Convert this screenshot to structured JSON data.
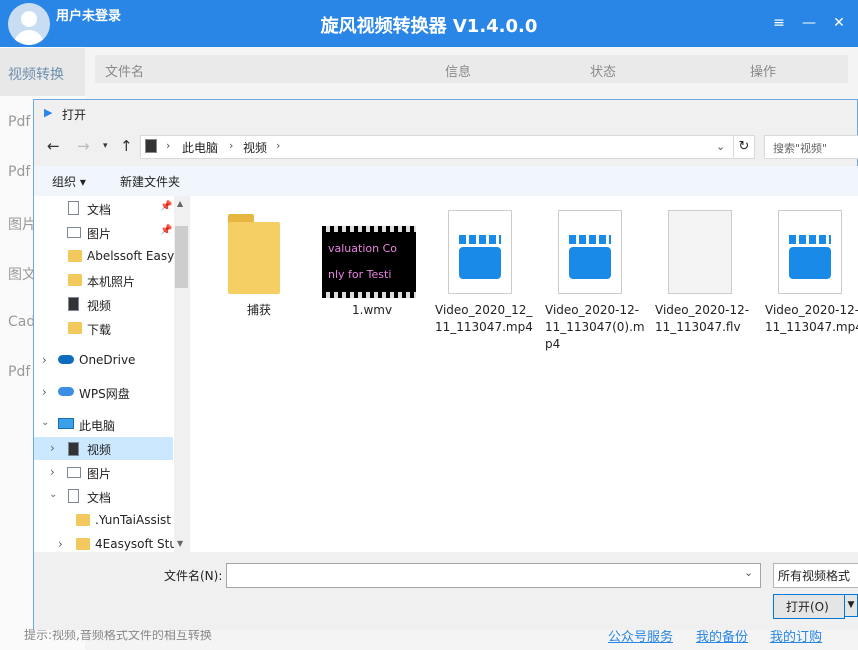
{
  "app": {
    "user_label": "用户未登录",
    "title": "旋风视频转换器 V1.4.0.0",
    "window_buttons": [
      "≡",
      "—",
      "☐",
      "✕"
    ]
  },
  "sidebar": {
    "items": [
      {
        "label": "视频转换"
      },
      {
        "label": "Pdf"
      },
      {
        "label": "Pdf"
      },
      {
        "label": "图片"
      },
      {
        "label": "图文"
      },
      {
        "label": "Cad"
      },
      {
        "label": "Pdf"
      }
    ]
  },
  "table": {
    "columns": [
      "文件名",
      "信息",
      "状态",
      "操作"
    ]
  },
  "statusbar": {
    "hint": "提示:视频,音频格式文件的相互转换",
    "links": [
      "公众号服务",
      "我的备份",
      "我的订购"
    ]
  },
  "dialog": {
    "title": "打开",
    "breadcrumb": [
      "此电脑",
      "视频"
    ],
    "search_placeholder": "搜索\"视频\"",
    "toolbar": {
      "organize": "组织 ▾",
      "new_folder": "新建文件夹"
    },
    "nav_items": [
      {
        "label": "文档",
        "icon": "document-icon",
        "pinned": true
      },
      {
        "label": "图片",
        "icon": "pictures-icon",
        "pinned": true
      },
      {
        "label": "Abelssoft Easy",
        "icon": "folder-icon"
      },
      {
        "label": "本机照片",
        "icon": "folder-icon"
      },
      {
        "label": "视频",
        "icon": "video-folder-icon"
      },
      {
        "label": "下载",
        "icon": "folder-icon"
      },
      {
        "label": "OneDrive",
        "icon": "cloud-icon"
      },
      {
        "label": "WPS网盘",
        "icon": "cloud-icon"
      },
      {
        "label": "此电脑",
        "icon": "computer-icon"
      },
      {
        "label": "视频",
        "icon": "video-folder-icon"
      },
      {
        "label": "图片",
        "icon": "pictures-icon"
      },
      {
        "label": "文档",
        "icon": "document-icon"
      },
      {
        "label": ".YunTaiAssist",
        "icon": "folder-icon"
      },
      {
        "label": "4Easysoft Stu",
        "icon": "folder-icon"
      }
    ],
    "files": [
      {
        "name": "捕获",
        "icon": "folder-icon"
      },
      {
        "name": "1.wmv",
        "icon": "video-thumbnail-icon",
        "thumb_text": [
          "valuation Co",
          "nly for Testi"
        ]
      },
      {
        "name": "Video_2020_12_\n11_113047.mp4",
        "icon": "video-file-icon"
      },
      {
        "name": "Video_2020-12-\n11_113047(0).m\np4",
        "icon": "video-file-icon"
      },
      {
        "name": "Video_2020-12-\n11_113047.flv",
        "icon": "blank-file-icon"
      },
      {
        "name": "Video_2020-12-\n11_113047.mp4",
        "icon": "video-file-icon"
      }
    ],
    "filename_label": "文件名(N):",
    "filename_value": "",
    "filter": "所有视频格式",
    "open_button": "打开(O)"
  },
  "colors": {
    "accent": "#2a86e6",
    "selection": "#cce8ff"
  }
}
